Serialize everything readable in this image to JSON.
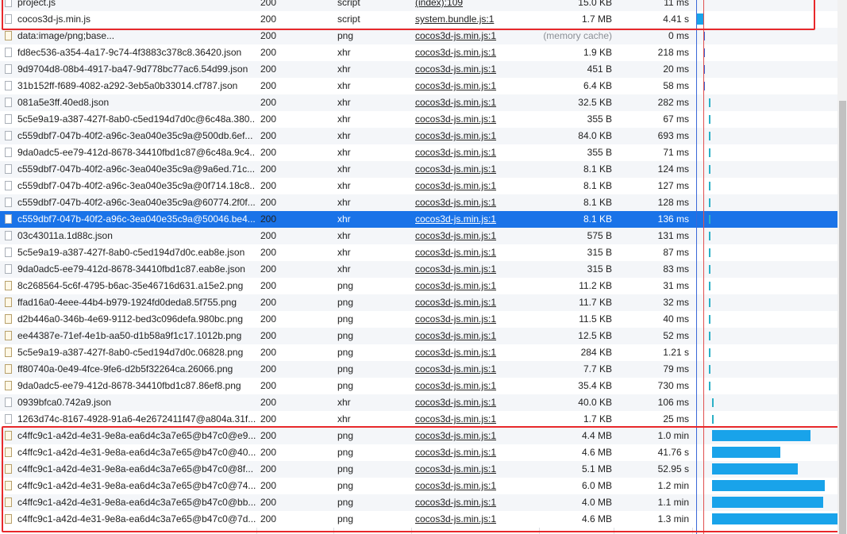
{
  "rows": [
    {
      "name": "project.js",
      "status": "200",
      "type": "script",
      "initiator": "(index):109",
      "size": "15.0 KB",
      "time": "11 ms",
      "icon": "js-file-icon"
    },
    {
      "name": "cocos3d-js.min.js",
      "status": "200",
      "type": "script",
      "initiator": "system.bundle.js:1",
      "size": "1.7 MB",
      "time": "4.41 s",
      "icon": "js-file-icon"
    },
    {
      "name": "data:image/png;base...",
      "status": "200",
      "type": "png",
      "initiator": "cocos3d-js.min.js:1",
      "size": "(memory cache)",
      "time": "0 ms",
      "icon": "image-file-icon"
    },
    {
      "name": "fd8ec536-a354-4a17-9c74-4f3883c378c8.36420.json",
      "status": "200",
      "type": "xhr",
      "initiator": "cocos3d-js.min.js:1",
      "size": "1.9 KB",
      "time": "218 ms",
      "icon": "file-icon"
    },
    {
      "name": "9d9704d8-08b4-4917-ba47-9d778bc77ac6.54d99.json",
      "status": "200",
      "type": "xhr",
      "initiator": "cocos3d-js.min.js:1",
      "size": "451 B",
      "time": "20 ms",
      "icon": "file-icon"
    },
    {
      "name": "31b152ff-f689-4082-a292-3eb5a0b33014.cf787.json",
      "status": "200",
      "type": "xhr",
      "initiator": "cocos3d-js.min.js:1",
      "size": "6.4 KB",
      "time": "58 ms",
      "icon": "file-icon"
    },
    {
      "name": "081a5e3ff.40ed8.json",
      "status": "200",
      "type": "xhr",
      "initiator": "cocos3d-js.min.js:1",
      "size": "32.5 KB",
      "time": "282 ms",
      "icon": "file-icon"
    },
    {
      "name": "5c5e9a19-a387-427f-8ab0-c5ed194d7d0c@6c48a.380...",
      "status": "200",
      "type": "xhr",
      "initiator": "cocos3d-js.min.js:1",
      "size": "355 B",
      "time": "67 ms",
      "icon": "file-icon"
    },
    {
      "name": "c559dbf7-047b-40f2-a96c-3ea040e35c9a@500db.6ef...",
      "status": "200",
      "type": "xhr",
      "initiator": "cocos3d-js.min.js:1",
      "size": "84.0 KB",
      "time": "693 ms",
      "icon": "file-icon"
    },
    {
      "name": "9da0adc5-ee79-412d-8678-34410fbd1c87@6c48a.9c4...",
      "status": "200",
      "type": "xhr",
      "initiator": "cocos3d-js.min.js:1",
      "size": "355 B",
      "time": "71 ms",
      "icon": "file-icon"
    },
    {
      "name": "c559dbf7-047b-40f2-a96c-3ea040e35c9a@9a6ed.71c...",
      "status": "200",
      "type": "xhr",
      "initiator": "cocos3d-js.min.js:1",
      "size": "8.1 KB",
      "time": "124 ms",
      "icon": "file-icon"
    },
    {
      "name": "c559dbf7-047b-40f2-a96c-3ea040e35c9a@0f714.18c8...",
      "status": "200",
      "type": "xhr",
      "initiator": "cocos3d-js.min.js:1",
      "size": "8.1 KB",
      "time": "127 ms",
      "icon": "file-icon"
    },
    {
      "name": "c559dbf7-047b-40f2-a96c-3ea040e35c9a@60774.2f0f...",
      "status": "200",
      "type": "xhr",
      "initiator": "cocos3d-js.min.js:1",
      "size": "8.1 KB",
      "time": "128 ms",
      "icon": "file-icon"
    },
    {
      "name": "c559dbf7-047b-40f2-a96c-3ea040e35c9a@50046.be4...",
      "status": "200",
      "type": "xhr",
      "initiator": "cocos3d-js.min.js:1",
      "size": "8.1 KB",
      "time": "136 ms",
      "icon": "file-icon"
    },
    {
      "name": "03c43011a.1d88c.json",
      "status": "200",
      "type": "xhr",
      "initiator": "cocos3d-js.min.js:1",
      "size": "575 B",
      "time": "131 ms",
      "icon": "file-icon"
    },
    {
      "name": "5c5e9a19-a387-427f-8ab0-c5ed194d7d0c.eab8e.json",
      "status": "200",
      "type": "xhr",
      "initiator": "cocos3d-js.min.js:1",
      "size": "315 B",
      "time": "87 ms",
      "icon": "file-icon"
    },
    {
      "name": "9da0adc5-ee79-412d-8678-34410fbd1c87.eab8e.json",
      "status": "200",
      "type": "xhr",
      "initiator": "cocos3d-js.min.js:1",
      "size": "315 B",
      "time": "83 ms",
      "icon": "file-icon"
    },
    {
      "name": "8c268564-5c6f-4795-b6ac-35e46716d631.a15e2.png",
      "status": "200",
      "type": "png",
      "initiator": "cocos3d-js.min.js:1",
      "size": "11.2 KB",
      "time": "31 ms",
      "icon": "image-file-icon"
    },
    {
      "name": "ffad16a0-4eee-44b4-b979-1924fd0deda8.5f755.png",
      "status": "200",
      "type": "png",
      "initiator": "cocos3d-js.min.js:1",
      "size": "11.7 KB",
      "time": "32 ms",
      "icon": "image-file-icon"
    },
    {
      "name": "d2b446a0-346b-4e69-9112-bed3c096defa.980bc.png",
      "status": "200",
      "type": "png",
      "initiator": "cocos3d-js.min.js:1",
      "size": "11.5 KB",
      "time": "40 ms",
      "icon": "image-file-icon"
    },
    {
      "name": "ee44387e-71ef-4e1b-aa50-d1b58a9f1c17.1012b.png",
      "status": "200",
      "type": "png",
      "initiator": "cocos3d-js.min.js:1",
      "size": "12.5 KB",
      "time": "52 ms",
      "icon": "image-file-icon"
    },
    {
      "name": "5c5e9a19-a387-427f-8ab0-c5ed194d7d0c.06828.png",
      "status": "200",
      "type": "png",
      "initiator": "cocos3d-js.min.js:1",
      "size": "284 KB",
      "time": "1.21 s",
      "icon": "image-file-icon"
    },
    {
      "name": "ff80740a-0e49-4fce-9fe6-d2b5f32264ca.26066.png",
      "status": "200",
      "type": "png",
      "initiator": "cocos3d-js.min.js:1",
      "size": "7.7 KB",
      "time": "79 ms",
      "icon": "image-file-icon"
    },
    {
      "name": "9da0adc5-ee79-412d-8678-34410fbd1c87.86ef8.png",
      "status": "200",
      "type": "png",
      "initiator": "cocos3d-js.min.js:1",
      "size": "35.4 KB",
      "time": "730 ms",
      "icon": "image-file-icon"
    },
    {
      "name": "0939bfca0.742a9.json",
      "status": "200",
      "type": "xhr",
      "initiator": "cocos3d-js.min.js:1",
      "size": "40.0 KB",
      "time": "106 ms",
      "icon": "file-icon"
    },
    {
      "name": "1263d74c-8167-4928-91a6-4e2672411f47@a804a.31f...",
      "status": "200",
      "type": "xhr",
      "initiator": "cocos3d-js.min.js:1",
      "size": "1.7 KB",
      "time": "25 ms",
      "icon": "file-icon"
    },
    {
      "name": "c4ffc9c1-a42d-4e31-9e8a-ea6d4c3a7e65@b47c0@e9...",
      "status": "200",
      "type": "png",
      "initiator": "cocos3d-js.min.js:1",
      "size": "4.4 MB",
      "time": "1.0 min",
      "icon": "image-file-icon"
    },
    {
      "name": "c4ffc9c1-a42d-4e31-9e8a-ea6d4c3a7e65@b47c0@40...",
      "status": "200",
      "type": "png",
      "initiator": "cocos3d-js.min.js:1",
      "size": "4.6 MB",
      "time": "41.76 s",
      "icon": "image-file-icon"
    },
    {
      "name": "c4ffc9c1-a42d-4e31-9e8a-ea6d4c3a7e65@b47c0@8f...",
      "status": "200",
      "type": "png",
      "initiator": "cocos3d-js.min.js:1",
      "size": "5.1 MB",
      "time": "52.95 s",
      "icon": "image-file-icon"
    },
    {
      "name": "c4ffc9c1-a42d-4e31-9e8a-ea6d4c3a7e65@b47c0@74...",
      "status": "200",
      "type": "png",
      "initiator": "cocos3d-js.min.js:1",
      "size": "6.0 MB",
      "time": "1.2 min",
      "icon": "image-file-icon"
    },
    {
      "name": "c4ffc9c1-a42d-4e31-9e8a-ea6d4c3a7e65@b47c0@bb...",
      "status": "200",
      "type": "png",
      "initiator": "cocos3d-js.min.js:1",
      "size": "4.0 MB",
      "time": "1.1 min",
      "icon": "image-file-icon"
    },
    {
      "name": "c4ffc9c1-a42d-4e31-9e8a-ea6d4c3a7e65@b47c0@7d...",
      "status": "200",
      "type": "png",
      "initiator": "cocos3d-js.min.js:1",
      "size": "4.6 MB",
      "time": "1.3 min",
      "icon": "image-file-icon"
    }
  ],
  "selected_index": 13,
  "colors": {
    "waterfall_bar": "#19a3ea",
    "highlight": "#e8282b",
    "selection": "#1a73e8"
  }
}
